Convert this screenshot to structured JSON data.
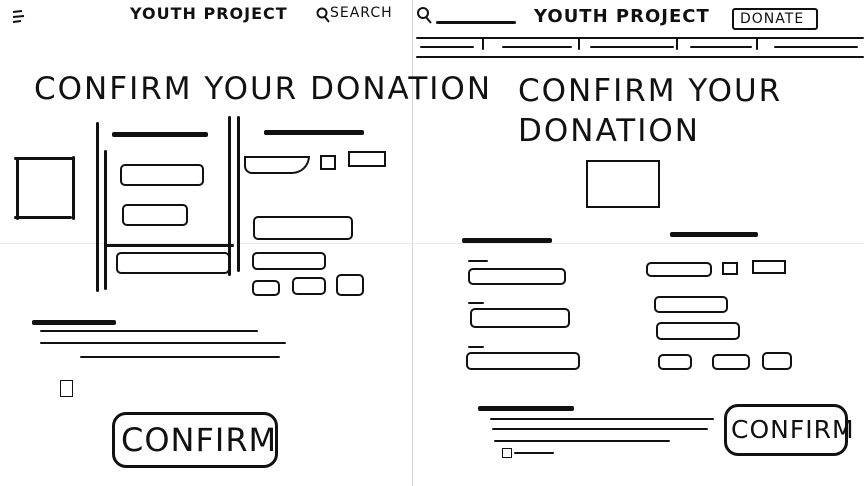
{
  "mobile": {
    "header": {
      "menu_icon": "hamburger-menu-icon",
      "title": "YOUTH PROJECT",
      "search_label": "SEARCH",
      "search_icon": "search-icon"
    },
    "heading": "CONFIRM YOUR DONATION",
    "confirm_button": "CONFIRM"
  },
  "desktop": {
    "header": {
      "search_icon": "search-icon",
      "title": "YOUTH PROJECT",
      "donate_button": "DONATE"
    },
    "heading_line1": "CONFIRM YOUR",
    "heading_line2": "DONATION",
    "confirm_button": "CONFIRM"
  }
}
